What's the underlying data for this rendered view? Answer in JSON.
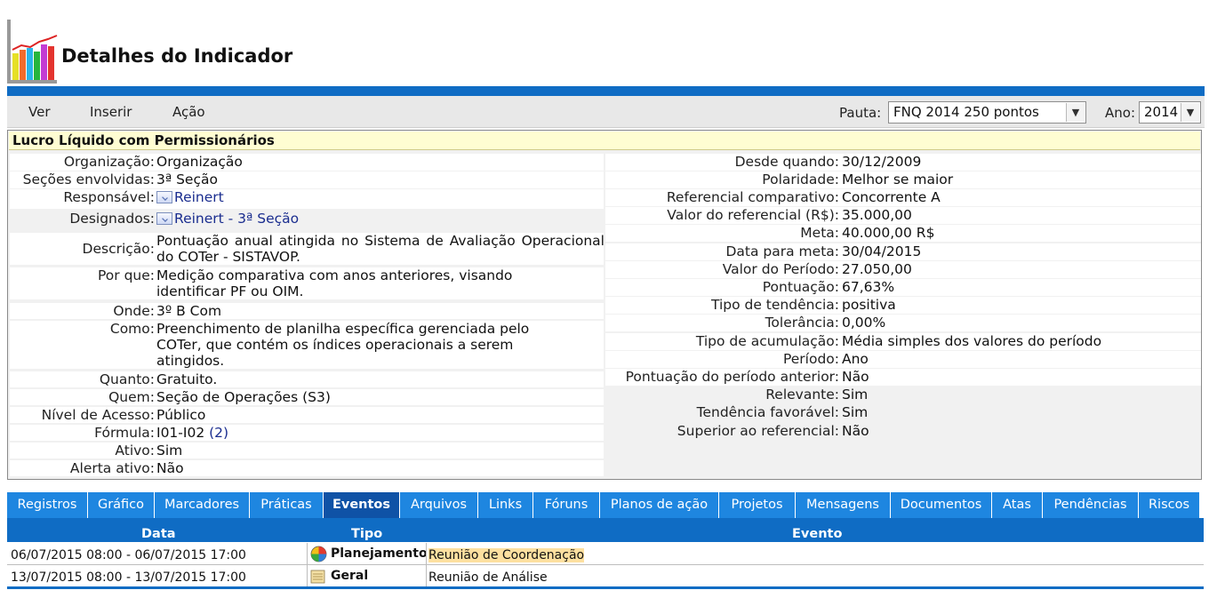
{
  "page": {
    "title": "Detalhes do Indicador"
  },
  "menu": {
    "items": [
      "Ver",
      "Inserir",
      "Ação"
    ]
  },
  "filters": {
    "pauta_label": "Pauta:",
    "pauta_value": "FNQ 2014 250 pontos",
    "ano_label": "Ano:",
    "ano_value": "2014"
  },
  "indicator": {
    "name": "Lucro Líquido com Permissionários",
    "left": [
      {
        "label": "Organização:",
        "value": "Organização"
      },
      {
        "label": "Seções envolvidas:",
        "value": "3ª Seção"
      },
      {
        "label": "Responsável:",
        "value": "Reinert"
      },
      {
        "label": "Designados:",
        "value": "Reinert - 3ª Seção"
      },
      {
        "label": "Descrição:",
        "value": "Pontuação anual atingida no Sistema de Avaliação Operacional do COTer - SISTAVOP."
      },
      {
        "label": "Por que:",
        "value": "Medição comparativa com anos anteriores, visando identificar PF ou OIM."
      },
      {
        "label": "Onde:",
        "value": "3º B Com"
      },
      {
        "label": "Como:",
        "value": "Preenchimento de planilha específica gerenciada pelo COTer, que contém os índices operacionais a serem atingidos."
      },
      {
        "label": "Quanto:",
        "value": "Gratuito."
      },
      {
        "label": "Quem:",
        "value": "Seção de Operações (S3)"
      },
      {
        "label": "Nível de Acesso:",
        "value": "Público"
      },
      {
        "label": "Fórmula:",
        "value": "I01-I02",
        "extra": "(2)"
      },
      {
        "label": "Ativo:",
        "value": "Sim"
      },
      {
        "label": "Alerta ativo:",
        "value": "Não"
      }
    ],
    "right": [
      {
        "label": "Desde quando:",
        "value": "30/12/2009"
      },
      {
        "label": "Polaridade:",
        "value": "Melhor se maior"
      },
      {
        "label": "Referencial comparativo:",
        "value": "Concorrente A"
      },
      {
        "label": "Valor do referencial (R$):",
        "value": "35.000,00"
      },
      {
        "label": "Meta:",
        "value": "40.000,00 R$"
      },
      {
        "label": "Data para meta:",
        "value": "30/04/2015"
      },
      {
        "label": "Valor do Período:",
        "value": "27.050,00"
      },
      {
        "label": "Pontuação:",
        "value": "67,63%"
      },
      {
        "label": "Tipo de tendência:",
        "value": "positiva"
      },
      {
        "label": "Tolerância:",
        "value": "0,00%"
      },
      {
        "label": "Tipo de acumulação:",
        "value": "Média simples dos valores do período"
      },
      {
        "label": "Período:",
        "value": "Ano"
      },
      {
        "label": "Pontuação do período anterior:",
        "value": "Não"
      },
      {
        "label": "Relevante:",
        "value": "Sim"
      },
      {
        "label": "Tendência favorável:",
        "value": "Sim"
      },
      {
        "label": "Superior ao referencial:",
        "value": "Não"
      }
    ]
  },
  "tabs": [
    "Registros",
    "Gráfico",
    "Marcadores",
    "Práticas",
    "Eventos",
    "Arquivos",
    "Links",
    "Fóruns",
    "Planos de ação",
    "Projetos",
    "Mensagens",
    "Documentos",
    "Atas",
    "Pendências",
    "Riscos"
  ],
  "active_tab": "Eventos",
  "events": {
    "headers": [
      "Data",
      "Tipo",
      "Evento"
    ],
    "rows": [
      {
        "data": "06/07/2015 08:00 - 06/07/2015 17:00",
        "tipo": "Planejamento",
        "evento": "Reunião de Coordenação"
      },
      {
        "data": "13/07/2015 08:00 - 13/07/2015 17:00",
        "tipo": "Geral",
        "evento": "Reunião de Análise"
      }
    ]
  },
  "colors": {
    "brand_blue": "#0f6cc4",
    "tab_blue": "#1e86e0",
    "tab_active": "#0f52a6",
    "positive": "#1c9a2e",
    "negative": "#e10000"
  }
}
